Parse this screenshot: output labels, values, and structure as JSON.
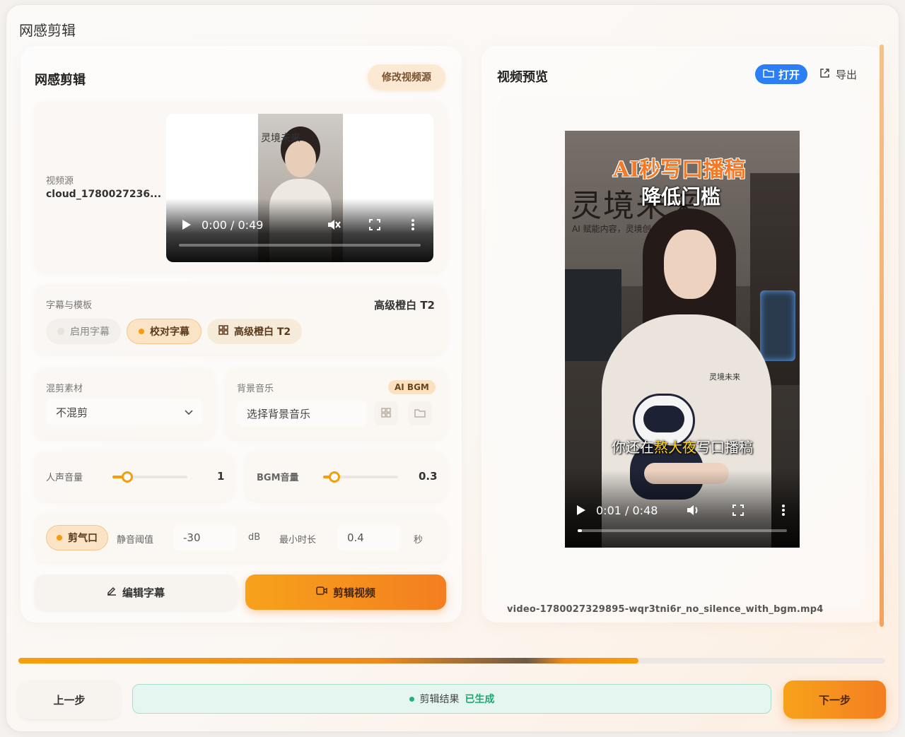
{
  "app": {
    "window_title": "网感剪辑"
  },
  "left": {
    "title": "网感剪辑",
    "change_source_label": "修改视频源",
    "source": {
      "label": "视频源",
      "name": "cloud_1780027236...",
      "thumb_text": "灵境未来",
      "player": {
        "time": "0:00 / 0:49",
        "progress": 0.0
      }
    },
    "subtitle": {
      "label": "字幕与模板",
      "current_template": "高级橙白 T2",
      "chips": {
        "enable": "启用字幕",
        "proofread": "校对字幕",
        "template": "高级橙白 T2"
      }
    },
    "mix": {
      "label": "混剪素材",
      "value": "不混剪"
    },
    "bgm": {
      "label": "背景音乐",
      "badge": "AI BGM",
      "placeholder": "选择背景音乐"
    },
    "voice_volume": {
      "label": "人声音量",
      "value": "1",
      "level": 0.2
    },
    "bgm_volume": {
      "label": "BGM音量",
      "value": "0.3",
      "level": 0.15
    },
    "trim": {
      "toggle_label": "剪气口",
      "threshold_label": "静音阈值",
      "threshold_value": "-30",
      "threshold_unit": "dB",
      "min_duration_label": "最小时长",
      "min_duration_value": "0.4",
      "min_duration_unit": "秒"
    },
    "buttons": {
      "edit_subtitles": "编辑字幕",
      "cut_video": "剪辑视频"
    }
  },
  "right": {
    "title": "视频预览",
    "open_label": "打开",
    "export_label": "导出",
    "video": {
      "title_line1": "AI秒写口播稿",
      "title_line2": "降低门槛",
      "wall_sign": "灵境未来",
      "wall_sub": "AI 赋能内容，灵境创",
      "hoodie_text": "灵境未来",
      "subtitle_pre": "你还在",
      "subtitle_highlight": "熬大夜",
      "subtitle_post": "写口播稿",
      "time": "0:01 / 0:48",
      "progress": 0.02
    },
    "file_name": "video-1780027329895-wqr3tni6r_no_silence_with_bgm.mp4"
  },
  "footer": {
    "progress": 0.715,
    "prev_label": "上一步",
    "status_label": "剪辑结果",
    "status_value": "已生成",
    "next_label": "下一步"
  },
  "colors": {
    "accent": "#f59e0b",
    "accent_dark": "#f47e21",
    "open_blue": "#2b7ef6",
    "success": "#22b07d"
  },
  "icons": [
    "play-icon",
    "mute-icon",
    "fullscreen-icon",
    "more-icon",
    "grid-icon",
    "folder-icon",
    "chevron-down-icon",
    "edit-icon",
    "cut-icon",
    "external-link-icon",
    "volume-icon"
  ]
}
